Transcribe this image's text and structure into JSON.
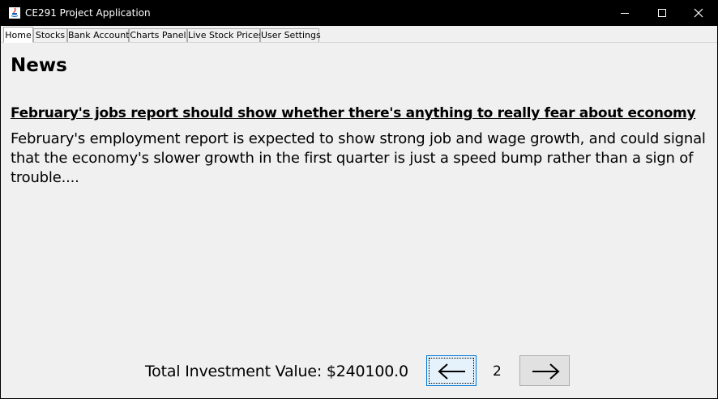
{
  "window": {
    "title": "CE291 Project Application"
  },
  "tabs": [
    {
      "label": "Home",
      "active": true
    },
    {
      "label": "Stocks",
      "active": false
    },
    {
      "label": "Bank Account",
      "active": false
    },
    {
      "label": "Charts Panel",
      "active": false
    },
    {
      "label": "Live Stock Prices",
      "active": false
    },
    {
      "label": "User Settings",
      "active": false
    }
  ],
  "news": {
    "heading": "News",
    "headline": "February's jobs report should show whether there's anything to really fear about economy",
    "summary": "February's employment report is expected to show strong job and wage growth, and could signal that the economy's slower growth in the first quarter is just a speed bump rather than a sign of trouble...."
  },
  "footer": {
    "total_investment": "Total Investment Value: $240100.0",
    "page_number": "2",
    "prev_icon": "arrow-left-icon",
    "next_icon": "arrow-right-icon"
  },
  "colors": {
    "titlebar": "#000000",
    "background": "#f0f0f0",
    "focus_border": "#0078d7"
  }
}
